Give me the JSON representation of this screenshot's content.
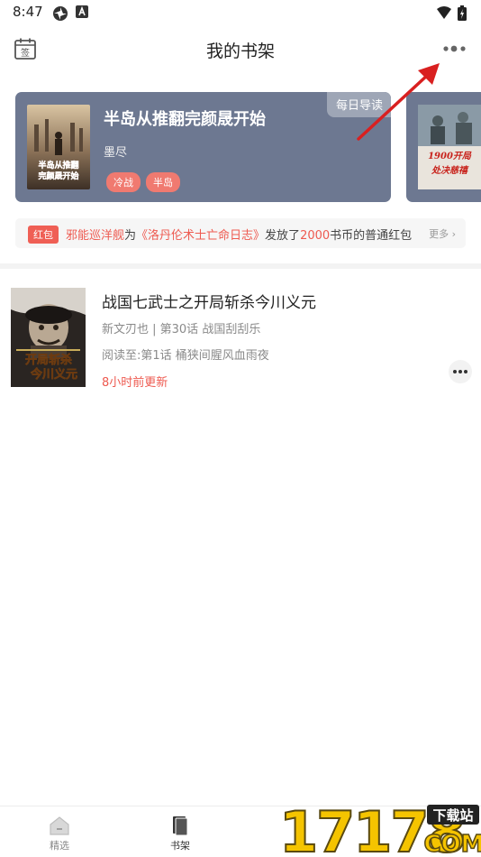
{
  "status_bar": {
    "time": "8:47"
  },
  "header": {
    "title": "我的书架",
    "checkin_icon_text": "签"
  },
  "featured": {
    "title": "半岛从推翻完颜晟开始",
    "author": "墨尽",
    "tags": [
      "冷战",
      "半岛"
    ],
    "badge": "每日导读",
    "cover_text": "半岛从推翻完颜晟开始",
    "peek_cover_text": "1900开局处决慈禧"
  },
  "notice": {
    "badge": "红包",
    "user": "邪能巡洋舰",
    "text_1": "为",
    "book": "《洛丹伦术士亡命日志》",
    "text_2": "发放了",
    "amount": "2000",
    "text_3": "书币的普通红包",
    "more": "更多"
  },
  "books": [
    {
      "title": "战国七武士之开局斩杀今川义元",
      "meta": "新文刃也 | 第30话 战国刮刮乐",
      "progress": "阅读至:第1话 桶狭间腥风血雨夜",
      "update": "8小时前更新",
      "cover_text": "开局斩杀今川义元"
    }
  ],
  "bottom_nav": {
    "items": [
      {
        "label": "精选",
        "icon": "home-icon"
      },
      {
        "label": "书架",
        "icon": "bookshelf-icon"
      }
    ]
  },
  "watermark": {
    "number": "17178",
    "tag": "下载站",
    "domain": "COM"
  },
  "colors": {
    "card_bg": "#6d7891",
    "accent_red": "#ee5a50",
    "tag_bg": "#f07a70"
  }
}
